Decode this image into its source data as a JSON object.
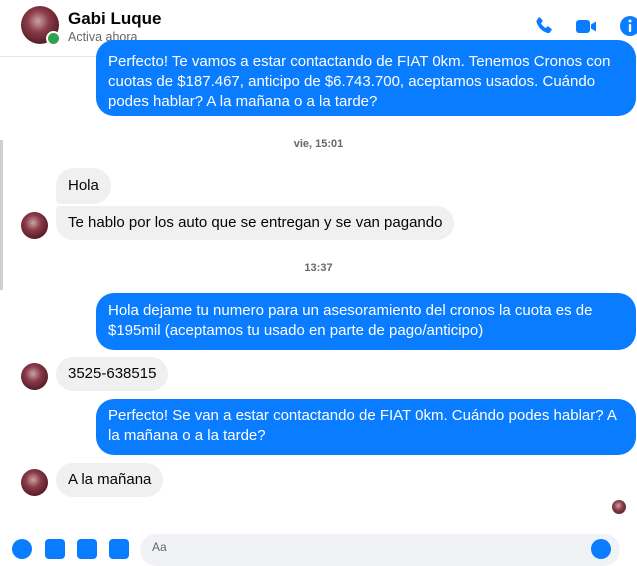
{
  "header": {
    "contact_name": "Gabi Luque",
    "contact_status": "Activa ahora",
    "icons": [
      "phone-icon",
      "video-icon",
      "info-icon"
    ]
  },
  "messages": {
    "m0": "Perfecto!  Te vamos a estar contactando de FIAT 0km. Tenemos Cronos con cuotas de $187.467, anticipo de $6.743.700, aceptamos usados. Cuándo podes hablar? A la mañana o a la tarde?",
    "stamp1": "vie, 15:01",
    "m1": "Hola",
    "m2": "Te hablo por los auto que se entregan y se van pagando",
    "stamp2": "13:37",
    "m3": "Hola dejame tu numero para un asesoramiento del cronos la cuota es de $195mil (aceptamos tu usado en parte de pago/anticipo)",
    "m4": "3525-638515",
    "m5": "Perfecto!  Se van a estar contactando de FIAT 0km. Cuándo podes hablar? A la mañana o a la tarde?",
    "m6": "A la mañana"
  },
  "composer": {
    "placeholder": "Aa"
  },
  "colors": {
    "outgoing": "#0a7cff",
    "incoming": "#f0f0f0",
    "accent": "#0a7cff",
    "online": "#31a24c"
  }
}
